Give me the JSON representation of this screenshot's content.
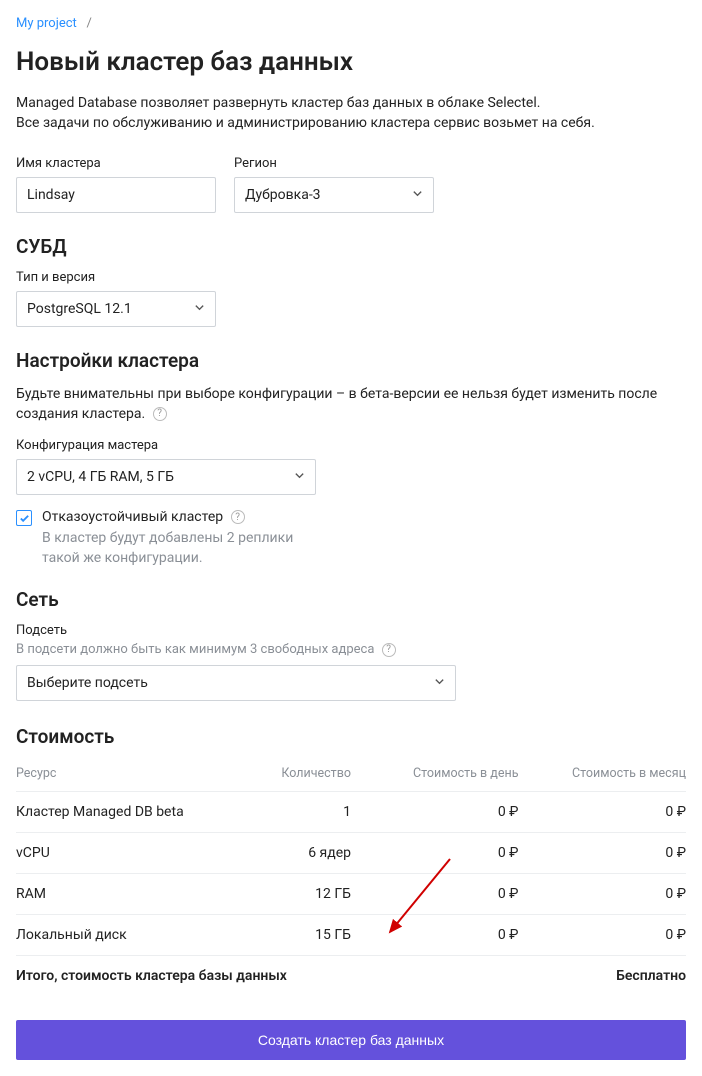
{
  "breadcrumb": {
    "project": "My project",
    "sep": "/"
  },
  "title": "Новый кластер баз данных",
  "subtitle_line1": "Managed Database позволяет развернуть кластер баз данных в облаке Selectel.",
  "subtitle_line2": "Все задачи по обслуживанию и администрированию кластера сервис возьмет на себя.",
  "cluster_name": {
    "label": "Имя кластера",
    "value": "Lindsay"
  },
  "region": {
    "label": "Регион",
    "value": "Дубровка-3"
  },
  "dbms": {
    "heading": "СУБД",
    "label": "Тип и версия",
    "value": "PostgreSQL 12.1"
  },
  "settings": {
    "heading": "Настройки кластера",
    "note": "Будьте внимательны при выборе конфигурации – в бета-версии ее нельзя будет изменить после создания кластера.",
    "config_label": "Конфигурация мастера",
    "config_value": "2 vCPU, 4 ГБ RAM, 5 ГБ",
    "ha_label": "Отказоустойчивый кластер",
    "ha_sub": "В кластер будут добавлены 2 реплики такой же конфигурации."
  },
  "network": {
    "heading": "Сеть",
    "subnet_label": "Подсеть",
    "subnet_hint": "В подсети должно быть как минимум 3 свободных адреса",
    "subnet_placeholder": "Выберите подсеть"
  },
  "pricing": {
    "heading": "Стоимость",
    "cols": {
      "resource": "Ресурс",
      "qty": "Количество",
      "day": "Стоимость в день",
      "month": "Стоимость в месяц"
    },
    "rows": [
      {
        "resource": "Кластер Managed DB beta",
        "qty": "1",
        "day": "0 ₽",
        "month": "0 ₽"
      },
      {
        "resource": "vCPU",
        "qty": "6 ядер",
        "day": "0 ₽",
        "month": "0 ₽"
      },
      {
        "resource": "RAM",
        "qty": "12 ГБ",
        "day": "0 ₽",
        "month": "0 ₽"
      },
      {
        "resource": "Локальный диск",
        "qty": "15 ГБ",
        "day": "0 ₽",
        "month": "0 ₽"
      }
    ],
    "total_label": "Итого, стоимость кластера базы данных",
    "total_value": "Бесплатно"
  },
  "submit": "Создать кластер баз данных"
}
